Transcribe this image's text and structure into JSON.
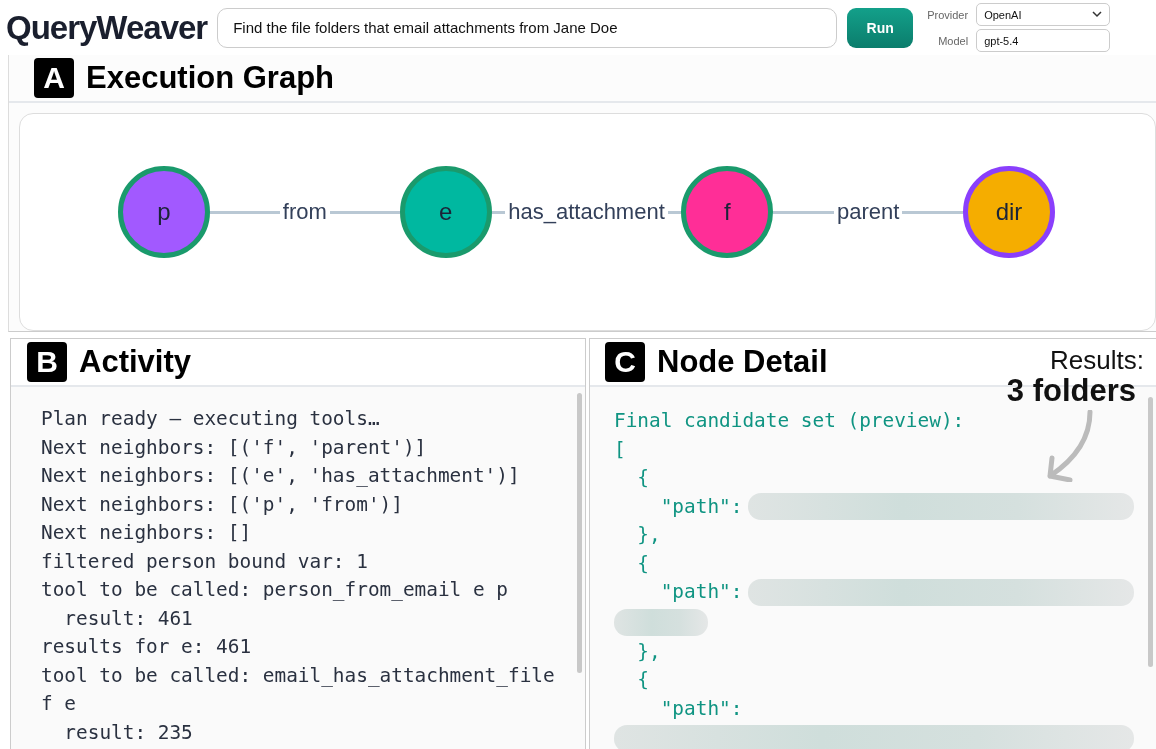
{
  "header": {
    "logo": "QueryWeaver",
    "query": "Find the file folders that email attachments from Jane Doe",
    "run_button": "Run",
    "provider_label": "Provider",
    "provider": "OpenAI",
    "model_label": "Model",
    "model": "gpt-5.4"
  },
  "graph_panel": {
    "badge": "A",
    "title": "Execution Graph",
    "nodes": [
      {
        "label": "p",
        "color": "#a259ff",
        "selected": false
      },
      {
        "label": "e",
        "color": "#00b8a0",
        "selected": false
      },
      {
        "label": "f",
        "color": "#ff2e97",
        "selected": false
      },
      {
        "label": "dir",
        "color": "#f5ad00",
        "selected": true
      }
    ],
    "edges": [
      "from",
      "has_attachment",
      "parent"
    ]
  },
  "activity_panel": {
    "badge": "B",
    "title": "Activity",
    "lines": [
      "Plan ready — executing tools…",
      "Next neighbors: [('f', 'parent')]",
      "Next neighbors: [('e', 'has_attachment')]",
      "Next neighbors: [('p', 'from')]",
      "Next neighbors: []",
      "filtered person bound var: 1",
      "tool to be called: person_from_email e p",
      "  result: 461",
      "results for e: 461",
      "tool to be called: email_has_attachment_file f e",
      "  result: 235"
    ]
  },
  "detail_panel": {
    "badge": "C",
    "title": "Node Detail",
    "annotation": {
      "label": "Results:",
      "value": "3 folders"
    },
    "lines": [
      {
        "kind": "text",
        "text": "Final candidate set (preview):"
      },
      {
        "kind": "text",
        "text": "["
      },
      {
        "kind": "text",
        "text": "  {"
      },
      {
        "kind": "inline",
        "text": "    \"path\":"
      },
      {
        "kind": "text",
        "text": "  },"
      },
      {
        "kind": "text",
        "text": "  {"
      },
      {
        "kind": "wrapped",
        "text": "    \"path\":"
      },
      {
        "kind": "text",
        "text": "  },"
      },
      {
        "kind": "text",
        "text": "  {"
      },
      {
        "kind": "below",
        "text": "    \"path\":"
      }
    ]
  }
}
